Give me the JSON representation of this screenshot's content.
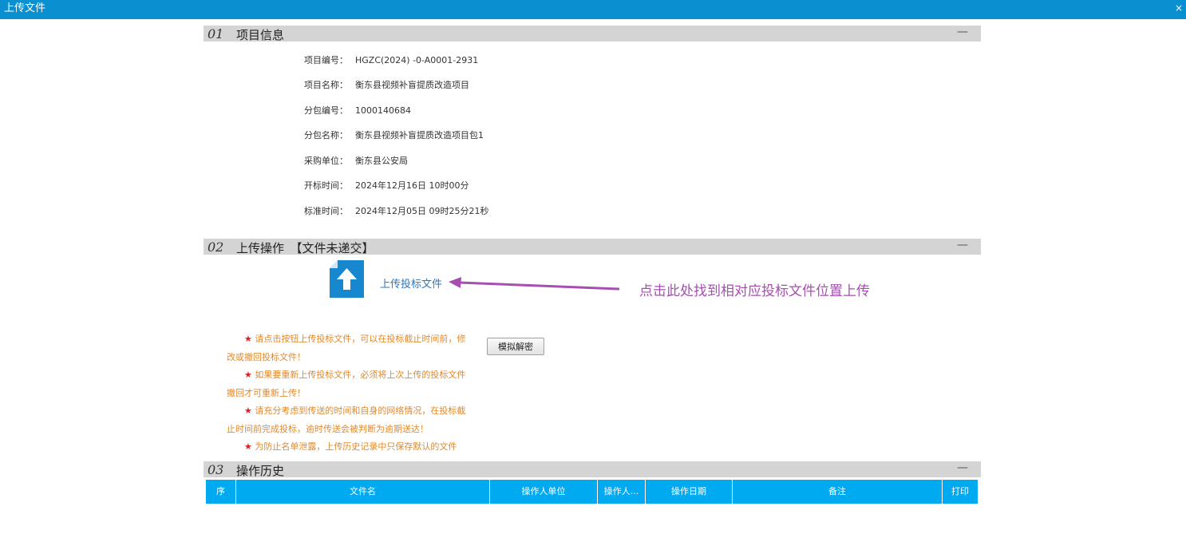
{
  "window": {
    "title": "上传文件",
    "close": "×"
  },
  "sections": {
    "info": {
      "num": "01",
      "title": "项目信息",
      "collapse": "—"
    },
    "upload": {
      "num": "02",
      "title": "上传操作　【文件未递交】",
      "collapse": "—"
    },
    "history": {
      "num": "03",
      "title": "操作历史",
      "collapse": "—"
    }
  },
  "project_info": [
    {
      "label": "项目编号：",
      "value": "HGZC(2024) -0-A0001-2931"
    },
    {
      "label": "项目名称：",
      "value": "衡东县视频补盲提质改造项目"
    },
    {
      "label": "分包编号：",
      "value": "1000140684"
    },
    {
      "label": "分包名称：",
      "value": "衡东县视频补盲提质改造项目包1"
    },
    {
      "label": "采购单位：",
      "value": "衡东县公安局"
    },
    {
      "label": "开标时间：",
      "value": "2024年12月16日 10时00分"
    },
    {
      "label": "标准时间：",
      "value": "2024年12月05日 09时25分21秒"
    }
  ],
  "upload": {
    "link_label": "上传投标文件",
    "annotation": "点击此处找到相对应投标文件位置上传",
    "simulate_button": "模拟解密",
    "notes": [
      "请点击按钮上传投标文件，可以在投标截止时间前，修改或撤回投标文件！",
      "如果要重新上传投标文件，必须将上次上传的投标文件撤回才可重新上传！",
      "请充分考虑到传送的时间和自身的网络情况，在投标截止时间前完成投标，逾时传送会被判断为逾期送达！",
      "为防止名单泄露，上传历史记录中只保存默认的文件"
    ],
    "star": "★"
  },
  "history_table": {
    "columns": [
      "序",
      "文件名",
      "操作人单位",
      "操作人...",
      "操作日期",
      "备注",
      "打印"
    ]
  },
  "colors": {
    "titlebar": "#0a8fd0",
    "section_bar": "#d4d4d4",
    "table_header": "#00aaf0",
    "link": "#2878c0",
    "annotation": "#a64fb0",
    "note_text": "#e08a2e",
    "star": "#e02020"
  }
}
